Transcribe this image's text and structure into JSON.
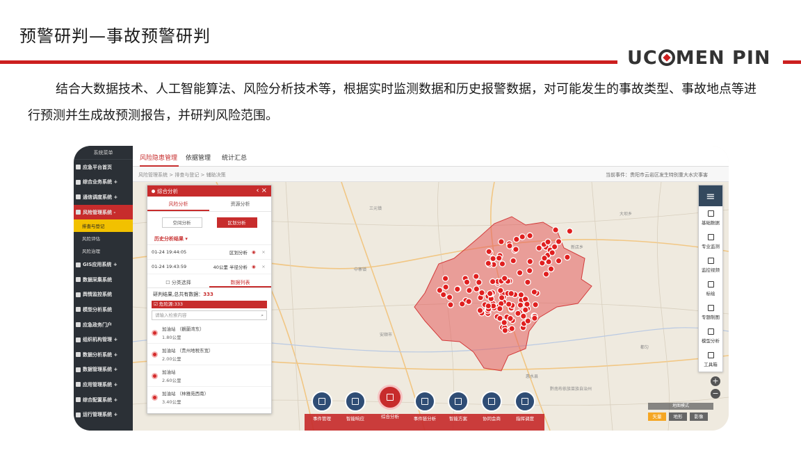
{
  "slide": {
    "title": "预警研判—事故预警研判",
    "brand": {
      "pre": "UC",
      "post": "MEN PIN"
    },
    "intro": "结合大数据技术、人工智能算法、风险分析技术等，根据实时监测数据和历史报警数据，对可能发生的事故类型、事故地点等进行预测并生成故预测报告，并研判风险范围。"
  },
  "colors": {
    "accent": "#c72c2c",
    "sidebar": "#2b3036",
    "dock_icon": "#2f4d75",
    "highlight": "#f2c100"
  },
  "sys_menu": {
    "header": "系统菜单",
    "items": [
      {
        "label": "应急平台首页"
      },
      {
        "label": "综合业务系统 +"
      },
      {
        "label": "通信调度系统 +"
      },
      {
        "label": "风险管理系统 -",
        "active": true
      },
      {
        "label": "GIS应用系统 +"
      },
      {
        "label": "数据采集系统"
      },
      {
        "label": "舆情监控系统"
      },
      {
        "label": "模型分析系统"
      },
      {
        "label": "应急政务门户"
      },
      {
        "label": "组织机构管理 +"
      },
      {
        "label": "数据分析系统 +"
      },
      {
        "label": "数据管理系统 +"
      },
      {
        "label": "应用管理系统 +"
      },
      {
        "label": "综合配置系统 +"
      },
      {
        "label": "运行管理系统 +"
      }
    ],
    "subitems": [
      "排查与登记",
      "风险评估",
      "风险治理"
    ]
  },
  "topbar": {
    "tabs": [
      "风险隐患管理",
      "依据管理",
      "统计汇总"
    ]
  },
  "breadcrumb": "风险管理系统 > 排查与登记 > 辅助决策",
  "current_event": "当前事件：贵阳市云岩区发生特别重大水灾事害",
  "panel": {
    "title": "综合分析",
    "tabs": [
      "风险分析",
      "资源分析"
    ],
    "buttons": [
      "空间分析",
      "区划分析"
    ],
    "history_title": "历史分析结果 ▾",
    "history": [
      {
        "time": "01-24 19:44:05",
        "mode": "区划分析"
      },
      {
        "time": "01-24 19:43:59",
        "mode": "40公里 半径分析"
      }
    ],
    "subtabs": [
      "☐ 分类选择",
      "数据列表"
    ],
    "result_label": "研判结果,总共有数据：",
    "result_count": "333",
    "risk_source": "☑ 危险源:333",
    "search_placeholder": "请输入检索内容",
    "list": [
      {
        "name": "加油站 （觀蘭湾东）",
        "dist": "1.80公里"
      },
      {
        "name": "加油站 （贵州地税东宽）",
        "dist": "2.00公里"
      },
      {
        "name": "加油站",
        "dist": "2.60公里"
      },
      {
        "name": "加油站 （林雅苑西南）",
        "dist": "3.40公里"
      }
    ]
  },
  "toolbar": {
    "items": [
      "基础数据",
      "专业监测",
      "监控视频",
      "标绘",
      "专题制图",
      "模型分析",
      "工具箱"
    ]
  },
  "dock": {
    "items": [
      "事件管理",
      "智能响应",
      "综合分析",
      "事件链分析",
      "智能方案",
      "协同会商",
      "指挥调度"
    ]
  },
  "maptype": {
    "label": "地图模式",
    "options": [
      "矢量",
      "地形",
      "影像"
    ]
  },
  "map_labels": [
    "三元镇",
    "中寨镇",
    "安顺市",
    "惠水县",
    "黔南布依族苗族自治州",
    "大坝乡",
    "新店乡",
    "都匀"
  ]
}
